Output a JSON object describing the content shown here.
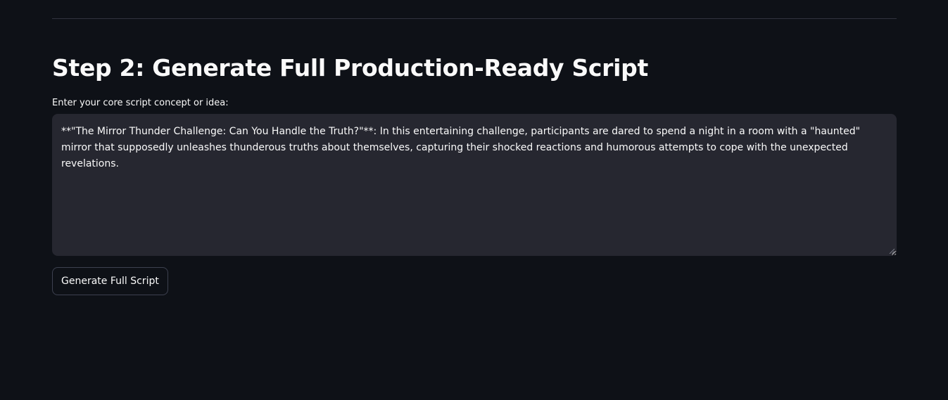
{
  "section": {
    "title": "Step 2: Generate Full Production-Ready Script",
    "input_label": "Enter your core script concept or idea:",
    "concept_value": "**\"The Mirror Thunder Challenge: Can You Handle the Truth?\"**: In this entertaining challenge, participants are dared to spend a night in a room with a \"haunted\" mirror that supposedly unleashes thunderous truths about themselves, capturing their shocked reactions and humorous attempts to cope with the unexpected revelations.",
    "generate_button_label": "Generate Full Script"
  },
  "colors": {
    "background": "#0e1117",
    "input_background": "#262730",
    "text": "#fafafa",
    "button_border": "#3d4150",
    "divider": "#31333f"
  }
}
